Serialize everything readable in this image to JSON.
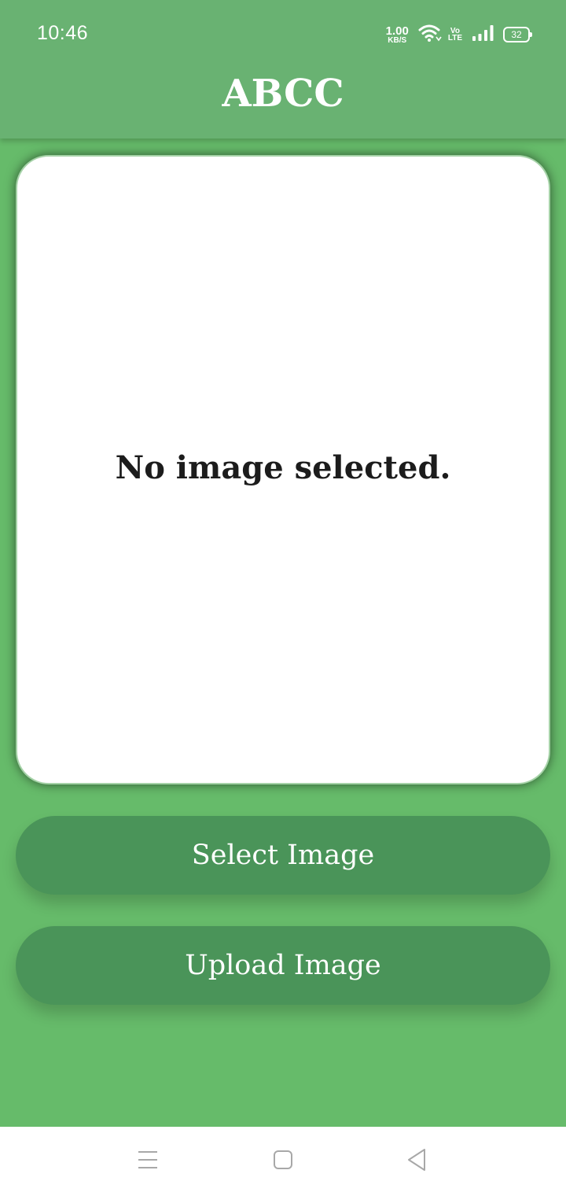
{
  "status_bar": {
    "time": "10:46",
    "net_speed_value": "1.00",
    "net_speed_unit": "KB/S",
    "volte_top": "Vo",
    "volte_bottom": "LTE",
    "battery_level": "32",
    "icons": [
      "wifi-icon",
      "signal-icon",
      "battery-icon"
    ]
  },
  "header": {
    "title": "ABCC"
  },
  "image_panel": {
    "placeholder": "No image selected."
  },
  "buttons": {
    "select_label": "Select Image",
    "upload_label": "Upload Image"
  },
  "nav_bar": {
    "icons": [
      "menu-icon",
      "home-icon",
      "back-icon"
    ]
  },
  "colors": {
    "background": "#66bb6a",
    "header": "#69b272",
    "button": "#4a9459",
    "card": "#ffffff",
    "text_dark": "#1c1c1c"
  }
}
